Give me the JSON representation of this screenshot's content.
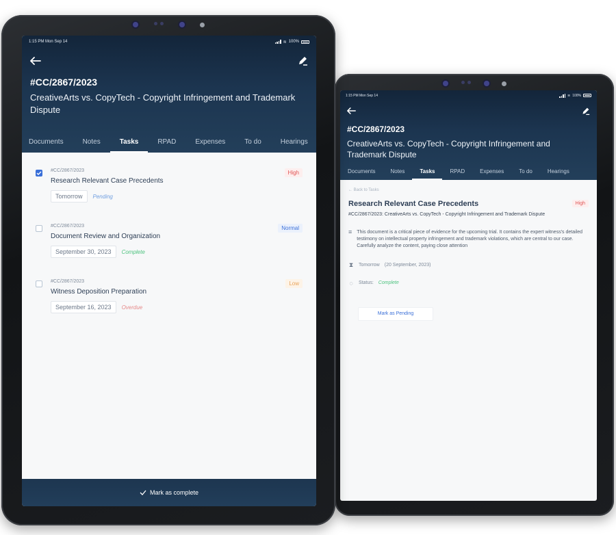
{
  "status_bar": {
    "time": "1:15 PM",
    "date": "Mon Sep 14",
    "battery": "100%"
  },
  "icons": {
    "back": "back-arrow-icon",
    "edit": "edit-pencil-icon",
    "check": "check-icon",
    "description": "lines-icon",
    "due": "hourglass-icon",
    "status": "spinner-icon"
  },
  "colors": {
    "header": "#1c3550",
    "accent": "#3a6fd8",
    "high": "#e05454",
    "normal": "#3a6fd8",
    "low": "#e8a35a",
    "pending": "#6f9ee0",
    "complete": "#4cc27e",
    "overdue": "#e68a8a"
  },
  "case": {
    "id": "#CC/2867/2023",
    "title": "CreativeArts vs. CopyTech - Copyright Infringement and Trademark Dispute"
  },
  "tabs": [
    {
      "label": "Documents"
    },
    {
      "label": "Notes"
    },
    {
      "label": "Tasks",
      "active": true
    },
    {
      "label": "RPAD"
    },
    {
      "label": "Expenses"
    },
    {
      "label": "To do"
    },
    {
      "label": "Hearings"
    }
  ],
  "tasks": [
    {
      "case_id": "#CC/2867/2023",
      "name": "Research Relevant Case Precedents",
      "date": "Tomorrow",
      "state": "Pending",
      "priority": "High",
      "checked": true
    },
    {
      "case_id": "#CC/2867/2023",
      "name": "Document Review and Organization",
      "date": "September 30, 2023",
      "state": "Complete",
      "priority": "Normal",
      "checked": false
    },
    {
      "case_id": "#CC/2867/2023",
      "name": "Witness Deposition Preparation",
      "date": "September 16, 2023",
      "state": "Overdue",
      "priority": "Low",
      "checked": false
    }
  ],
  "bottom_action": {
    "label": "Mark as complete"
  },
  "detail": {
    "back_label": "Back to Tasks",
    "title": "Research Relevant Case Precedents",
    "priority": "High",
    "subtitle": "#CC/2867/2023: CreativeArts vs. CopyTech - Copyright Infringement and Trademark Dispute",
    "description": "This document is a critical piece of evidence for the upcoming trial. It contains the expert witness's detailed testimony on intellectual property infringement and trademark violations, which are central to our case. Carefully analyze the content, paying close attention",
    "due_label": "Tomorrow",
    "due_date": "(20 September, 2023)",
    "status_label": "Status:",
    "status_value": "Complete",
    "action_label": "Mark as Pending"
  }
}
